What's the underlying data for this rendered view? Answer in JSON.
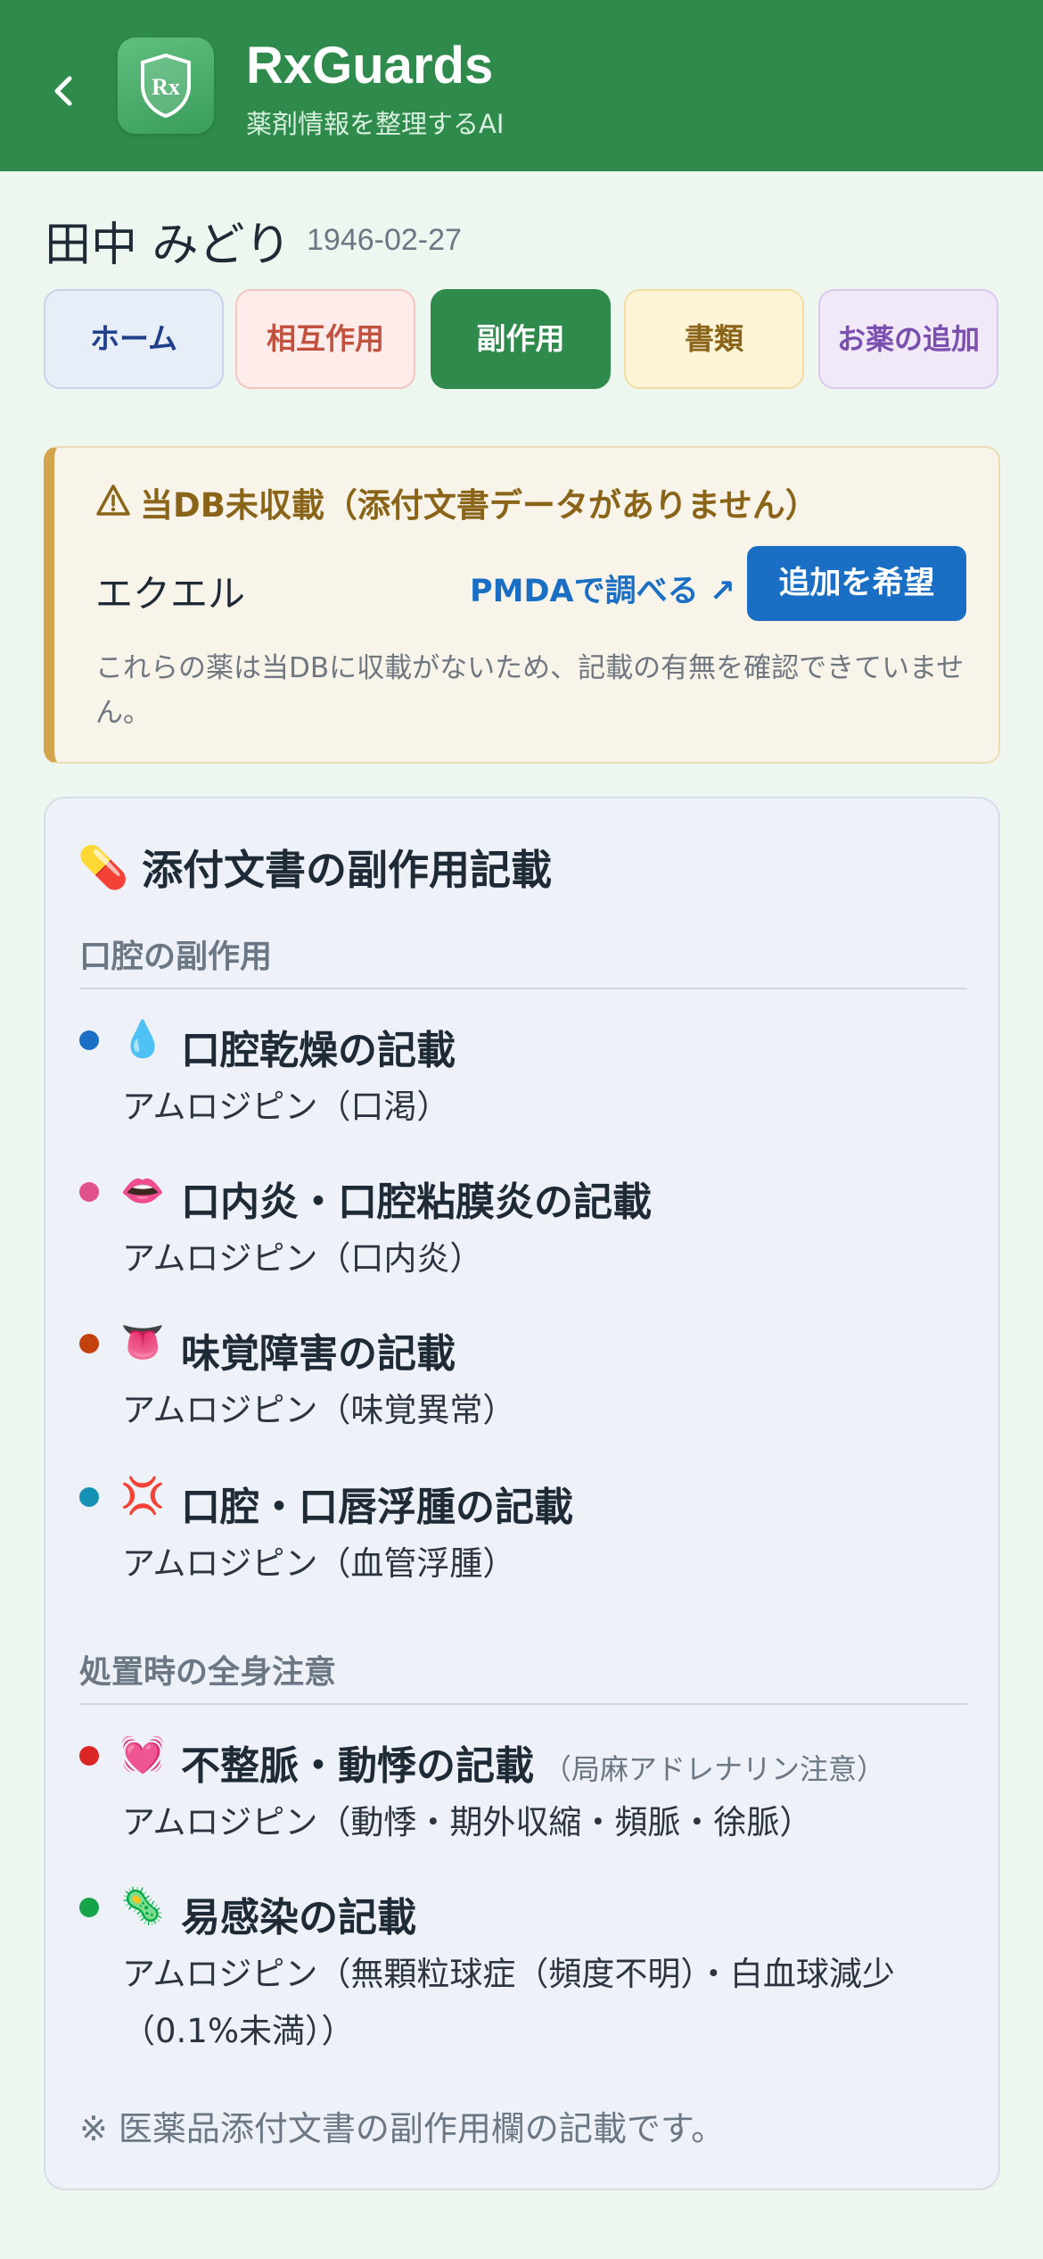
{
  "header": {
    "back_icon": "chevron-left-icon",
    "logo_text": "Rx",
    "app_title": "RxGuards",
    "app_subtitle": "薬剤情報を整理するAI",
    "background_color": "#2e8b4b"
  },
  "patient": {
    "name": "田中 みどり",
    "dob": "1946-02-27"
  },
  "tabs": [
    {
      "label": "ホーム",
      "active": false
    },
    {
      "label": "相互作用",
      "active": false
    },
    {
      "label": "副作用",
      "active": true
    },
    {
      "label": "書類",
      "active": false
    },
    {
      "label": "お薬の追加",
      "active": false
    }
  ],
  "warning": {
    "icon": "warning-icon",
    "title": "当DB未収載（添付文書データがありません）",
    "drug_name": "エクエル",
    "pmda_link": "PMDAで調べる ↗",
    "request_button": "追加を希望",
    "note": "これらの薬は当DBに収載がないため、記載の有無を確認できていません。"
  },
  "side_effects": {
    "title_icon": "💊",
    "title": "添付文書の副作用記載",
    "sections": [
      {
        "heading": "口腔の副作用",
        "items": [
          {
            "dot_color": "#1a6fc4",
            "icon": "💧",
            "title": "口腔乾燥の記載",
            "note": "",
            "desc": "アムロジピン（口渇）"
          },
          {
            "dot_color": "#e0528a",
            "icon": "👄",
            "title": "口内炎・口腔粘膜炎の記載",
            "note": "",
            "desc": "アムロジピン（口内炎）"
          },
          {
            "dot_color": "#c2410c",
            "icon": "👅",
            "title": "味覚障害の記載",
            "note": "",
            "desc": "アムロジピン（味覚異常）"
          },
          {
            "dot_color": "#1591b5",
            "icon": "💢",
            "title": "口腔・口唇浮腫の記載",
            "note": "",
            "desc": "アムロジピン（血管浮腫）"
          }
        ]
      },
      {
        "heading": "処置時の全身注意",
        "items": [
          {
            "dot_color": "#dc2626",
            "icon": "💓",
            "title": "不整脈・動悸の記載",
            "note": "（局麻アドレナリン注意）",
            "desc": "アムロジピン（動悸・期外収縮・頻脈・徐脈）"
          },
          {
            "dot_color": "#16a34a",
            "icon": "🦠",
            "title": "易感染の記載",
            "note": "",
            "desc": "アムロジピン（無顆粒球症（頻度不明）・白血球減少（0.1%未満））"
          }
        ]
      }
    ],
    "footnote": "※ 医薬品添付文書の副作用欄の記載です。"
  }
}
